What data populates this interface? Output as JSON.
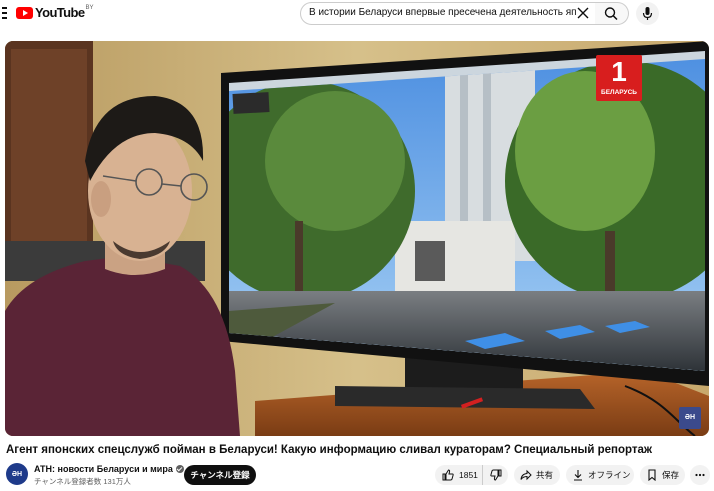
{
  "header": {
    "logo_text": "YouTube",
    "logo_region": "BY",
    "search_query": "В истории Беларуси впервые пресечена деятельность японских спецслужб",
    "icons": [
      "menu-icon",
      "youtube-logo-icon",
      "clear-search-icon",
      "search-icon",
      "microphone-icon"
    ]
  },
  "video": {
    "overlay_logo_number": "1",
    "overlay_logo_text": "БЕЛАРУСЬ",
    "corner_badge": "ӘН",
    "title": "Агент японских спецслужб пойман в Беларуси! Какую информацию сливал кураторам? Специальный репортаж"
  },
  "channel": {
    "avatar_text": "ӘН",
    "name": "АТН: новости Беларуси и мира",
    "subscribers": "チャンネル登録者数 131万人",
    "subscribe_label": "チャンネル登録"
  },
  "actions": {
    "like_count": "1851",
    "share_label": "共有",
    "download_label": "オフライン",
    "save_label": "保存"
  },
  "colors": {
    "brand_red": "#ff0000",
    "text": "#0f0f0f",
    "secondary": "#606060",
    "pill_bg": "#f2f2f2"
  }
}
